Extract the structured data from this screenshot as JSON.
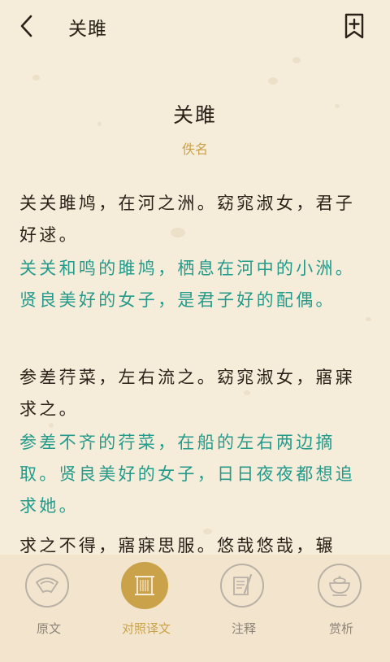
{
  "header": {
    "back_icon": "chevron-left-icon",
    "title": "关雎",
    "bookmark_icon": "bookmark-add-icon"
  },
  "poem": {
    "title": "关雎",
    "author": "佚名",
    "stanzas": [
      {
        "original": "关关雎鸠，在河之洲。窈窕淑女，君子好逑。",
        "translation": "关关和鸣的雎鸠，栖息在河中的小洲。贤良美好的女子，是君子好的配偶。"
      },
      {
        "original": "参差荇菜，左右流之。窈窕淑女，寤寐求之。",
        "translation": "参差不齐的荇菜，在船的左右两边摘取。贤良美好的女子，日日夜夜都想追求她。"
      },
      {
        "original": "求之不得，寤寐思服。悠哉悠哉，辗"
      }
    ]
  },
  "tabbar": {
    "tabs": [
      {
        "label": "原文",
        "icon": "fan-icon",
        "active": false
      },
      {
        "label": "对照译文",
        "icon": "scroll-icon",
        "active": true
      },
      {
        "label": "注释",
        "icon": "brush-paper-icon",
        "active": false
      },
      {
        "label": "赏析",
        "icon": "teacup-icon",
        "active": false
      }
    ]
  },
  "colors": {
    "background": "#f6ecda",
    "translation_text": "#239a8a",
    "accent_gold": "#c9a24a",
    "tab_inactive": "#8c8379"
  }
}
